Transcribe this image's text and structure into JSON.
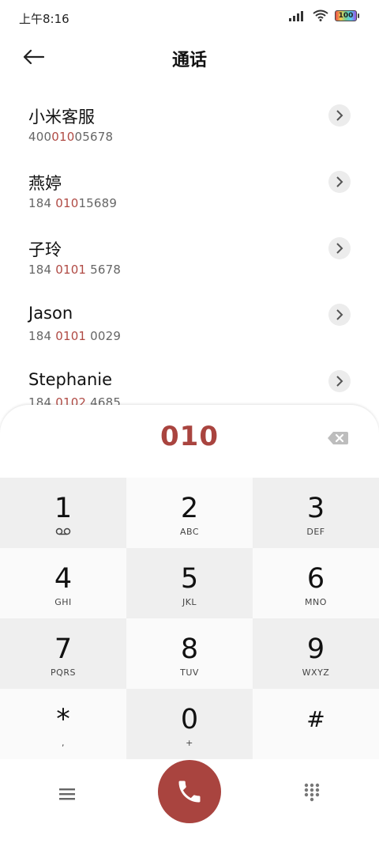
{
  "status_bar": {
    "time": "上午8:16",
    "battery": "100"
  },
  "header": {
    "title": "通话"
  },
  "contacts": [
    {
      "name": "小米客服",
      "num_pre": "400",
      "num_match": "010",
      "num_post": "05678"
    },
    {
      "name": "燕婷",
      "num_pre": "184 ",
      "num_match": "010",
      "num_post": "15689"
    },
    {
      "name": "子玲",
      "num_pre": "184 ",
      "num_match": "0101",
      "num_post": " 5678"
    },
    {
      "name": "Jason",
      "num_pre": "184 ",
      "num_match": "0101",
      "num_post": " 0029"
    },
    {
      "name": "Stephanie",
      "num_pre": "184 ",
      "num_match": "0102",
      "num_post": " 4685"
    }
  ],
  "dialer": {
    "input": "010",
    "keys": [
      {
        "digit": "1",
        "letters": ""
      },
      {
        "digit": "2",
        "letters": "ABC"
      },
      {
        "digit": "3",
        "letters": "DEF"
      },
      {
        "digit": "4",
        "letters": "GHI"
      },
      {
        "digit": "5",
        "letters": "JKL"
      },
      {
        "digit": "6",
        "letters": "MNO"
      },
      {
        "digit": "7",
        "letters": "PQRS"
      },
      {
        "digit": "8",
        "letters": "TUV"
      },
      {
        "digit": "9",
        "letters": "WXYZ"
      },
      {
        "digit": "*",
        "letters": ","
      },
      {
        "digit": "0",
        "letters": "+"
      },
      {
        "digit": "#",
        "letters": ""
      }
    ]
  },
  "colors": {
    "accent": "#a9443f",
    "match_highlight": "#b04a44",
    "key_gray": "#efefef",
    "key_light": "#fafafa"
  },
  "icons": {
    "back": "arrow-left-icon",
    "detail": "chevron-right-icon",
    "delete": "backspace-icon",
    "voicemail": "voicemail-icon",
    "menu": "menu-icon",
    "call": "phone-icon",
    "dialpad": "dialpad-icon"
  }
}
